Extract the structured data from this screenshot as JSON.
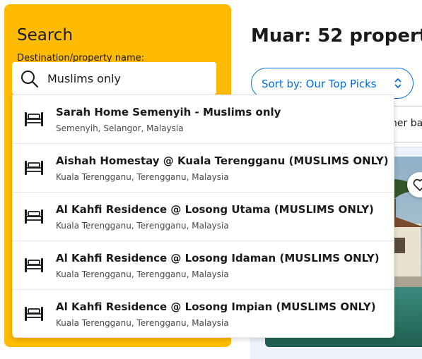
{
  "search": {
    "title": "Search",
    "field_label": "Destination/property name:",
    "value": "Muslims only",
    "icon": "search-icon"
  },
  "suggestions": [
    {
      "name": "Sarah Home Semenyih - Muslims only",
      "location": "Semenyih, Selangor, Malaysia",
      "icon": "bed-icon"
    },
    {
      "name": "Aishah Homestay @ Kuala Terengganu (MUSLIMS ONLY)",
      "location": "Kuala Terengganu, Terengganu, Malaysia",
      "icon": "bed-icon"
    },
    {
      "name": "Al Kahfi Residence @ Losong Utama (MUSLIMS ONLY)",
      "location": "Kuala Terengganu, Terengganu, Malaysia",
      "icon": "bed-icon"
    },
    {
      "name": "Al Kahfi Residence @ Losong Idaman (MUSLIMS ONLY)",
      "location": "Kuala Terengganu, Terengganu, Malaysia",
      "icon": "bed-icon"
    },
    {
      "name": "Al Kahfi Residence @ Losong Impian (MUSLIMS ONLY)",
      "location": "Kuala Terengganu, Terengganu, Malaysia",
      "icon": "bed-icon"
    }
  ],
  "results": {
    "title": "Muar: 52 propert",
    "sort_label": "Sort by: Our Top Picks",
    "filter_chip": "ner ba"
  },
  "colors": {
    "panel": "#febb02",
    "accent": "#006ce4",
    "text": "#1a1a1a"
  }
}
